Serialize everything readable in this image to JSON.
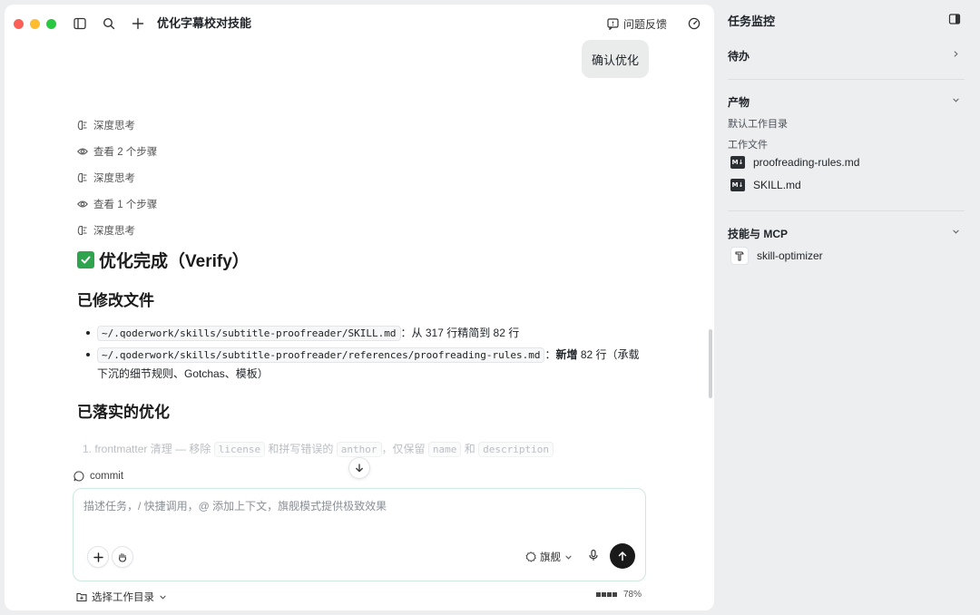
{
  "window": {
    "title": "优化字幕校对技能",
    "feedback_label": "问题反馈"
  },
  "conversation": {
    "user_message": "确认优化",
    "steps": [
      {
        "icon": "brain-icon",
        "label": "深度思考"
      },
      {
        "icon": "eye-icon",
        "label": "查看 2 个步骤"
      },
      {
        "icon": "brain-icon",
        "label": "深度思考"
      },
      {
        "icon": "eye-icon",
        "label": "查看 1 个步骤"
      },
      {
        "icon": "brain-icon",
        "label": "深度思考"
      }
    ],
    "heading": "优化完成（Verify）",
    "section_modified": "已修改文件",
    "modified_files": [
      {
        "path": "~/.qoderwork/skills/subtitle-proofreader/SKILL.md",
        "sep": "：",
        "desc": "从 317 行精简到 82 行",
        "bold": ""
      },
      {
        "path": "~/.qoderwork/skills/subtitle-proofreader/references/proofreading-rules.md",
        "sep": "：",
        "bold": "新增",
        "desc": " 82 行（承载下沉的细节规则、Gotchas、模板）"
      }
    ],
    "section_optimizations": "已落实的优化",
    "opt_item": {
      "prefix": "1. frontmatter 清理 — 移除",
      "code1": "license",
      "mid1": "和拼写错误的",
      "code2": "anthor",
      "mid2": "，仅保留",
      "code3": "name",
      "mid3": "和",
      "code4": "description"
    }
  },
  "composer": {
    "commit_label": "commit",
    "placeholder": "描述任务，/ 快捷调用，@ 添加上下文，旗舰模式提供极致效果",
    "mode_label": "旗舰",
    "workdir_label": "选择工作目录",
    "context_usage": "78%"
  },
  "sidebar": {
    "title": "任务监控",
    "todo_label": "待办",
    "artifacts_label": "产物",
    "default_dir_label": "默认工作目录",
    "work_files_label": "工作文件",
    "files": [
      {
        "name": "proofreading-rules.md",
        "icon": "markdown-icon"
      },
      {
        "name": "SKILL.md",
        "icon": "markdown-icon"
      }
    ],
    "skills_label": "技能与 MCP",
    "skills": [
      {
        "name": "skill-optimizer",
        "icon": "hammer-icon"
      }
    ]
  }
}
